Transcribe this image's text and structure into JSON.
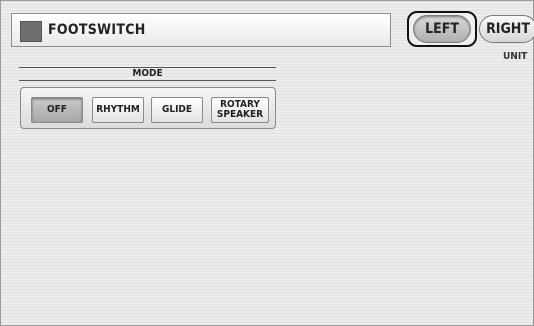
{
  "header": {
    "title": "FOOTSWITCH"
  },
  "unit_selector": {
    "left_label": "LEFT",
    "right_label": "RIGHT",
    "selected": "LEFT",
    "caption": "UNIT"
  },
  "mode": {
    "label": "MODE",
    "options": [
      "OFF",
      "RHYTHM",
      "GLIDE",
      "ROTARY\nSPEAKER"
    ],
    "selected": "OFF"
  }
}
